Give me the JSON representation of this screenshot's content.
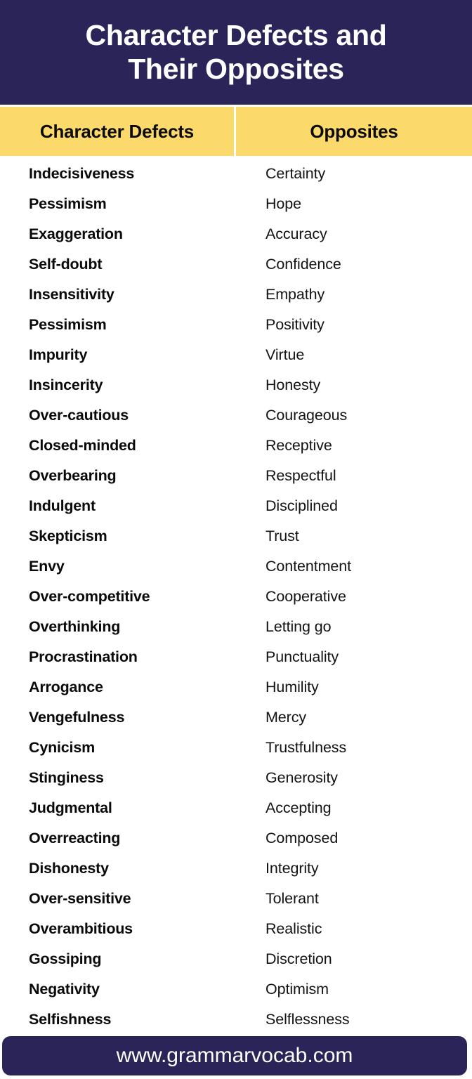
{
  "header": {
    "title": "Character Defects and\nTheir Opposites",
    "background_color": "#2B2458",
    "text_color": "#FFFFFF"
  },
  "table": {
    "header_background_color": "#FBD96B",
    "columns": [
      {
        "label": "Character Defects"
      },
      {
        "label": "Opposites"
      }
    ],
    "rows": [
      {
        "defect": "Indecisiveness",
        "opposite": "Certainty"
      },
      {
        "defect": "Pessimism",
        "opposite": "Hope"
      },
      {
        "defect": "Exaggeration",
        "opposite": "Accuracy"
      },
      {
        "defect": "Self-doubt",
        "opposite": "Confidence"
      },
      {
        "defect": "Insensitivity",
        "opposite": "Empathy"
      },
      {
        "defect": "Pessimism",
        "opposite": "Positivity"
      },
      {
        "defect": "Impurity",
        "opposite": "Virtue"
      },
      {
        "defect": "Insincerity",
        "opposite": "Honesty"
      },
      {
        "defect": "Over-cautious",
        "opposite": "Courageous"
      },
      {
        "defect": "Closed-minded",
        "opposite": "Receptive"
      },
      {
        "defect": "Overbearing",
        "opposite": "Respectful"
      },
      {
        "defect": "Indulgent",
        "opposite": "Disciplined"
      },
      {
        "defect": "Skepticism",
        "opposite": "Trust"
      },
      {
        "defect": "Envy",
        "opposite": "Contentment"
      },
      {
        "defect": "Over-competitive",
        "opposite": "Cooperative"
      },
      {
        "defect": "Overthinking",
        "opposite": "Letting go"
      },
      {
        "defect": "Procrastination",
        "opposite": "Punctuality"
      },
      {
        "defect": "Arrogance",
        "opposite": "Humility"
      },
      {
        "defect": "Vengefulness",
        "opposite": "Mercy"
      },
      {
        "defect": "Cynicism",
        "opposite": "Trustfulness"
      },
      {
        "defect": "Stinginess",
        "opposite": "Generosity"
      },
      {
        "defect": "Judgmental",
        "opposite": "Accepting"
      },
      {
        "defect": "Overreacting",
        "opposite": "Composed"
      },
      {
        "defect": "Dishonesty",
        "opposite": "Integrity"
      },
      {
        "defect": "Over-sensitive",
        "opposite": "Tolerant"
      },
      {
        "defect": "Overambitious",
        "opposite": "Realistic"
      },
      {
        "defect": "Gossiping",
        "opposite": "Discretion"
      },
      {
        "defect": "Negativity",
        "opposite": "Optimism"
      },
      {
        "defect": "Selfishness",
        "opposite": "Selflessness"
      }
    ]
  },
  "footer": {
    "website": "www.grammarvocab.com",
    "background_color": "#2B2458",
    "text_color": "#FFFFFF"
  }
}
